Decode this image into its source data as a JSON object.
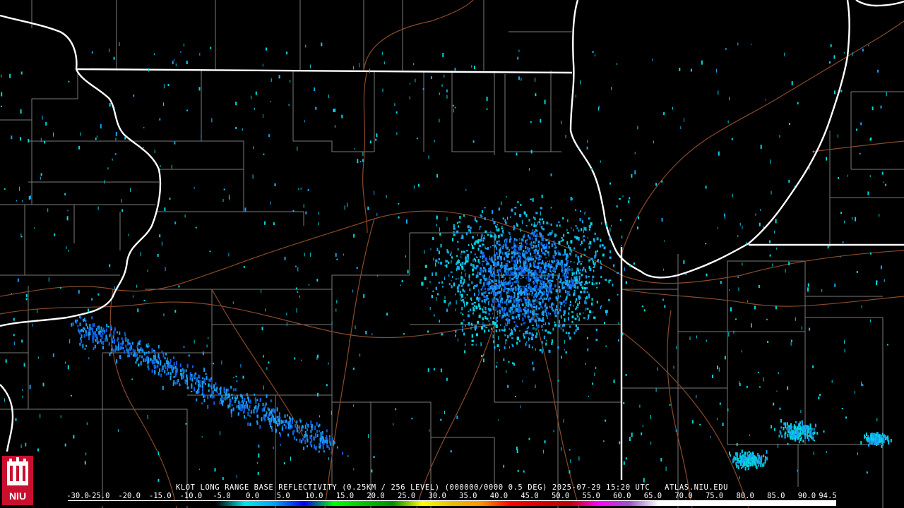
{
  "product": {
    "title": "KLOT LONG RANGE BASE REFLECTIVITY (0.25KM / 256 LEVEL) (000000/0000 0.5 DEG) 2025-07-29 15:20 UTC",
    "source": "ATLAS.NIU.EDU"
  },
  "logo": {
    "text": "NIU",
    "icon": "niu-university-logo"
  },
  "colorbar": {
    "ticks": [
      "-30.0",
      "-25.0",
      "-20.0",
      "-15.0",
      "-10.0",
      "-5.0",
      "0.0",
      "5.0",
      "10.0",
      "15.0",
      "20.0",
      "25.0",
      "30.0",
      "35.0",
      "40.0",
      "45.0",
      "50.0",
      "55.0",
      "60.0",
      "65.0",
      "70.0",
      "75.0",
      "80.0",
      "85.0",
      "90.0",
      "94.5"
    ],
    "colors": [
      "#000000",
      "#000000",
      "#000000",
      "#000000",
      "#000000",
      "#000000",
      "#00e8e8",
      "#01a0f6",
      "#0000f6",
      "#00ff00",
      "#00c800",
      "#009000",
      "#ffff00",
      "#e7c000",
      "#ff9000",
      "#ff0000",
      "#d60000",
      "#c00000",
      "#ff00ff",
      "#9955c9",
      "#ffffff",
      "#ffffff",
      "#ffffff",
      "#ffffff",
      "#ffffff",
      "#ffffff"
    ]
  },
  "map": {
    "region": "Northern Illinois / Chicago area",
    "layers": [
      "county-boundaries",
      "state-boundaries",
      "lake-michigan-shoreline",
      "interstate-highways",
      "radar-returns"
    ],
    "colors": {
      "background": "#000000",
      "county": "#7a7a7a",
      "state": "#ffffff",
      "highway": "#8a4b2a",
      "echo_low": "#00d8e0",
      "echo_mid": "#1aa0f0",
      "echo_high": "#1060e8"
    }
  }
}
